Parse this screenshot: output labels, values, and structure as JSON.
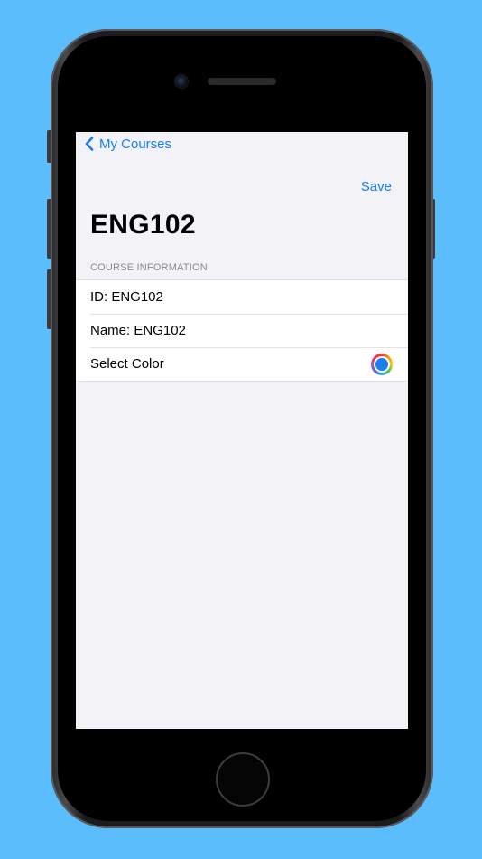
{
  "nav": {
    "back_label": "My Courses",
    "save_label": "Save"
  },
  "page": {
    "title": "ENG102"
  },
  "section": {
    "header": "COURSE INFORMATION",
    "rows": [
      {
        "label": "ID: ENG102"
      },
      {
        "label": "Name: ENG102"
      },
      {
        "label": "Select Color"
      }
    ]
  },
  "colors": {
    "accent": "#1a7df0",
    "selected_course_color": "#1a7df0",
    "background": "#5bbdfb"
  },
  "icons": {
    "back": "chevron-left-icon",
    "color_picker": "color-wheel-icon"
  }
}
